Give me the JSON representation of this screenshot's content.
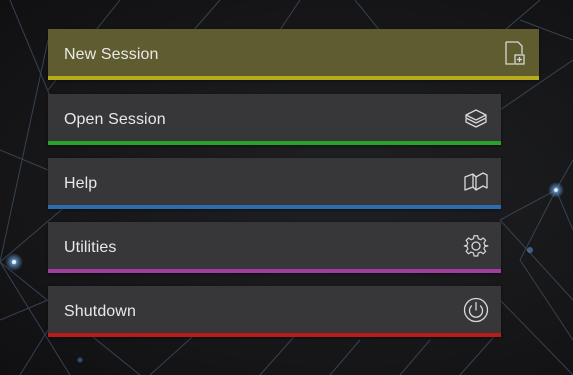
{
  "menu": {
    "items": [
      {
        "label": "New Session",
        "icon": "new-file-plus-icon",
        "accent": "#b7ac1c",
        "active": true
      },
      {
        "label": "Open Session",
        "icon": "stack-box-icon",
        "accent": "#27a22a",
        "active": false
      },
      {
        "label": "Help",
        "icon": "open-book-icon",
        "accent": "#2c6db0",
        "active": false
      },
      {
        "label": "Utilities",
        "icon": "gear-icon",
        "accent": "#a23ca3",
        "active": false
      },
      {
        "label": "Shutdown",
        "icon": "power-icon",
        "accent": "#b81c1c",
        "active": false
      }
    ]
  },
  "colors": {
    "background": "#161618",
    "item_background": "#37373a",
    "active_item_background": "#5f5c2f",
    "network_line": "#3f5066",
    "network_glow": "#6aa6e8"
  }
}
